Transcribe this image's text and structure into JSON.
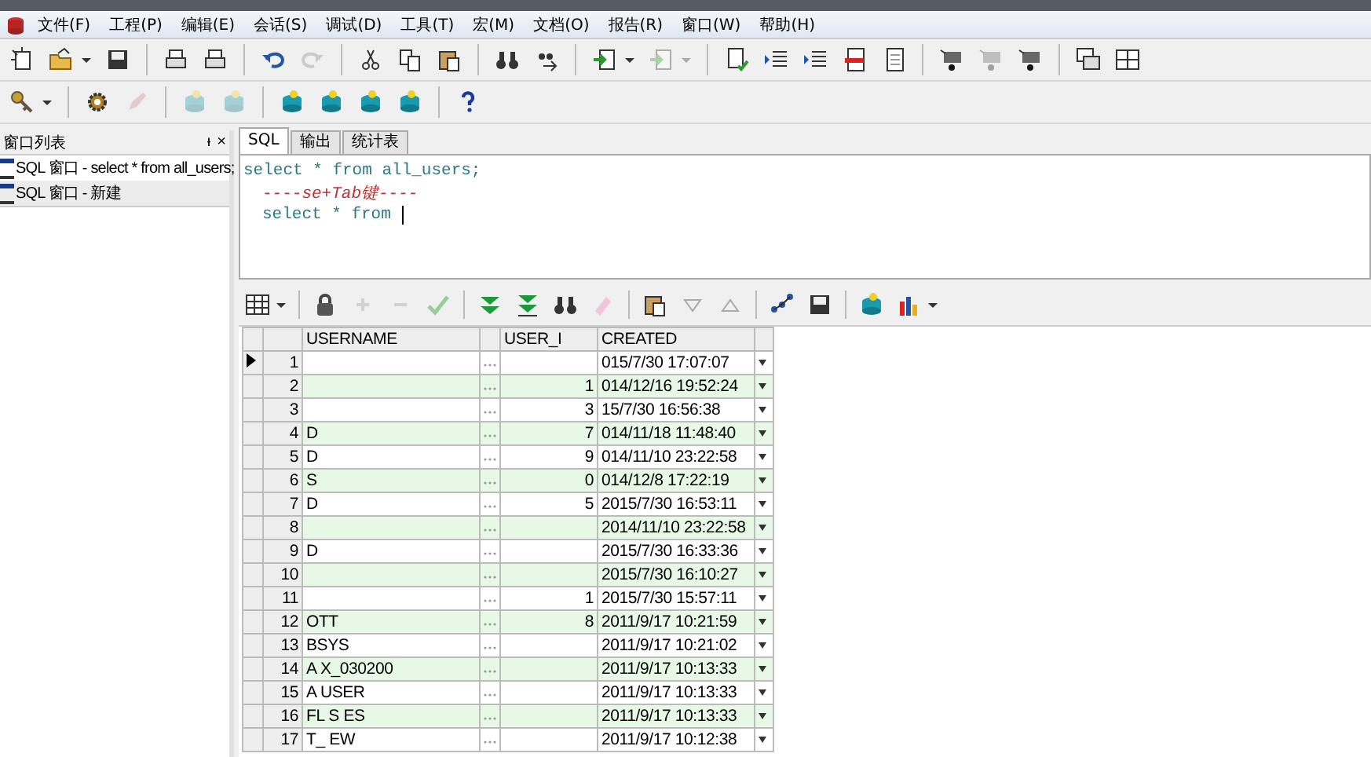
{
  "menu": [
    "文件(F)",
    "工程(P)",
    "编辑(E)",
    "会话(S)",
    "调试(D)",
    "工具(T)",
    "宏(M)",
    "文档(O)",
    "报告(R)",
    "窗口(W)",
    "帮助(H)"
  ],
  "window_list": {
    "title": "窗口列表",
    "pin": "ᵻ",
    "close": "×",
    "items": [
      {
        "label": "SQL 窗口 - select * from all_users;",
        "selected": false
      },
      {
        "label": "SQL 窗口 - 新建",
        "selected": true
      }
    ]
  },
  "tabs": [
    {
      "label": "SQL",
      "selected": true
    },
    {
      "label": "输出",
      "selected": false
    },
    {
      "label": "统计表",
      "selected": false
    }
  ],
  "editor": {
    "lines": [
      {
        "kind": "code",
        "text": "select * from all_users;",
        "caret": false
      },
      {
        "kind": "comment",
        "text": "----se+Tab键----",
        "caret": false
      },
      {
        "kind": "code",
        "text": "select * from ",
        "caret": true
      }
    ]
  },
  "grid": {
    "columns": [
      "USERNAME",
      "USER_I",
      "CREATED"
    ],
    "rows": [
      {
        "num": "1",
        "created": "015/7/30 17:07:07",
        "selected": true
      },
      {
        "num": "2",
        "user_id": "1",
        "created": "014/12/16 19:52:24",
        "selected": false
      },
      {
        "num": "3",
        "user_id": "3",
        "created": "15/7/30 16:56:38",
        "selected": false
      },
      {
        "num": "4",
        "username": "D",
        "user_id": "7",
        "created": "014/11/18 11:48:40",
        "selected": false
      },
      {
        "num": "5",
        "username": "D",
        "user_id": "9",
        "created": "014/11/10 23:22:58",
        "selected": false
      },
      {
        "num": "6",
        "username": "S",
        "user_id": "0",
        "created": "014/12/8 17:22:19",
        "selected": false
      },
      {
        "num": "7",
        "username": "D",
        "user_id": "5",
        "created": "2015/7/30 16:53:11",
        "selected": false
      },
      {
        "num": "8",
        "created": "2014/11/10 23:22:58",
        "selected": false
      },
      {
        "num": "9",
        "username": "D",
        "created": "2015/7/30 16:33:36",
        "selected": false
      },
      {
        "num": "10",
        "created": "2015/7/30 16:10:27",
        "selected": false
      },
      {
        "num": "11",
        "user_id": "1",
        "created": "2015/7/30 15:57:11",
        "selected": false
      },
      {
        "num": "12",
        "username": "OTT",
        "user_id": "8",
        "created": "2011/9/17 10:21:59",
        "selected": false
      },
      {
        "num": "13",
        "username": "BSYS",
        "created": "2011/9/17 10:21:02",
        "selected": false
      },
      {
        "num": "14",
        "username": "A     X_030200",
        "created": "2011/9/17 10:13:33",
        "selected": false
      },
      {
        "num": "15",
        "username": "A            USER",
        "created": "2011/9/17 10:13:33",
        "selected": false
      },
      {
        "num": "16",
        "username": "FL     S     ES",
        "created": "2011/9/17 10:13:33",
        "selected": false
      },
      {
        "num": "17",
        "username": "T_    EW",
        "created": "2011/9/17 10:12:38",
        "selected": false
      }
    ]
  }
}
